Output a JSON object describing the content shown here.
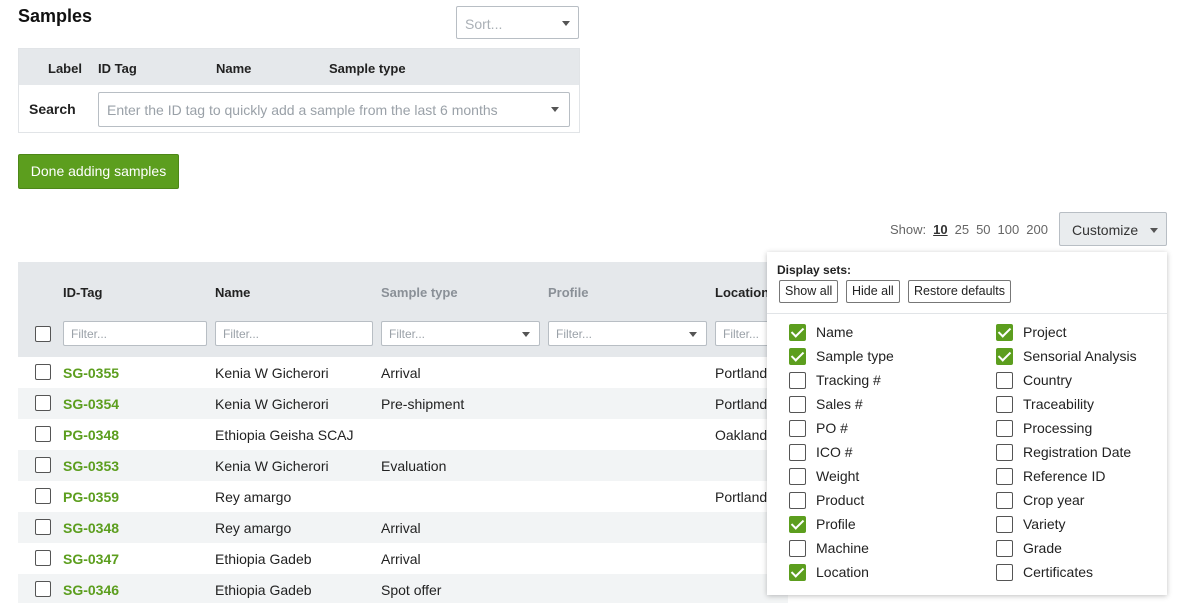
{
  "page": {
    "title": "Samples"
  },
  "sort": {
    "placeholder": "Sort..."
  },
  "search_panel": {
    "headers": [
      "Label",
      "ID Tag",
      "Name",
      "Sample type"
    ],
    "search_label": "Search",
    "search_placeholder": "Enter the ID tag to quickly add a sample from the last 6 months"
  },
  "done_button": {
    "label": "Done adding samples"
  },
  "pagination": {
    "label": "Show:",
    "options": [
      "10",
      "25",
      "50",
      "100",
      "200"
    ],
    "selected": "10"
  },
  "customize": {
    "label": "Customize"
  },
  "table": {
    "columns": [
      "ID-Tag",
      "Name",
      "Sample type",
      "Profile",
      "Location"
    ],
    "filter_placeholder": "Filter...",
    "rows": [
      {
        "id": "SG-0355",
        "name": "Kenia W Gicherori",
        "sample_type": "Arrival",
        "location": "Portland"
      },
      {
        "id": "SG-0354",
        "name": "Kenia W Gicherori",
        "sample_type": "Pre-shipment",
        "location": "Portland"
      },
      {
        "id": "PG-0348",
        "name": "Ethiopia Geisha SCAJ",
        "sample_type": "",
        "location": "Oakland"
      },
      {
        "id": "SG-0353",
        "name": "Kenia W Gicherori",
        "sample_type": "Evaluation",
        "location": ""
      },
      {
        "id": "PG-0359",
        "name": "Rey amargo",
        "sample_type": "",
        "location": "Portland"
      },
      {
        "id": "SG-0348",
        "name": "Rey amargo",
        "sample_type": "Arrival",
        "location": ""
      },
      {
        "id": "SG-0347",
        "name": "Ethiopia Gadeb",
        "sample_type": "Arrival",
        "location": ""
      },
      {
        "id": "SG-0346",
        "name": "Ethiopia Gadeb",
        "sample_type": "Spot offer",
        "location": ""
      }
    ]
  },
  "customize_panel": {
    "title": "Display sets:",
    "buttons": [
      "Show all",
      "Hide all",
      "Restore defaults"
    ],
    "left_options": [
      {
        "label": "Name",
        "checked": true
      },
      {
        "label": "Sample type",
        "checked": true
      },
      {
        "label": "Tracking #",
        "checked": false
      },
      {
        "label": "Sales #",
        "checked": false
      },
      {
        "label": "PO #",
        "checked": false
      },
      {
        "label": "ICO #",
        "checked": false
      },
      {
        "label": "Weight",
        "checked": false
      },
      {
        "label": "Product",
        "checked": false
      },
      {
        "label": "Profile",
        "checked": true
      },
      {
        "label": "Machine",
        "checked": false
      },
      {
        "label": "Location",
        "checked": true
      }
    ],
    "right_options": [
      {
        "label": "Project",
        "checked": true
      },
      {
        "label": "Sensorial Analysis",
        "checked": true
      },
      {
        "label": "Country",
        "checked": false
      },
      {
        "label": "Traceability",
        "checked": false
      },
      {
        "label": "Processing",
        "checked": false
      },
      {
        "label": "Registration Date",
        "checked": false
      },
      {
        "label": "Reference ID",
        "checked": false
      },
      {
        "label": "Crop year",
        "checked": false
      },
      {
        "label": "Variety",
        "checked": false
      },
      {
        "label": "Grade",
        "checked": false
      },
      {
        "label": "Certificates",
        "checked": false
      }
    ]
  },
  "colors": {
    "accent": "#5c9e1e",
    "header_bg": "#e5e8eb"
  }
}
